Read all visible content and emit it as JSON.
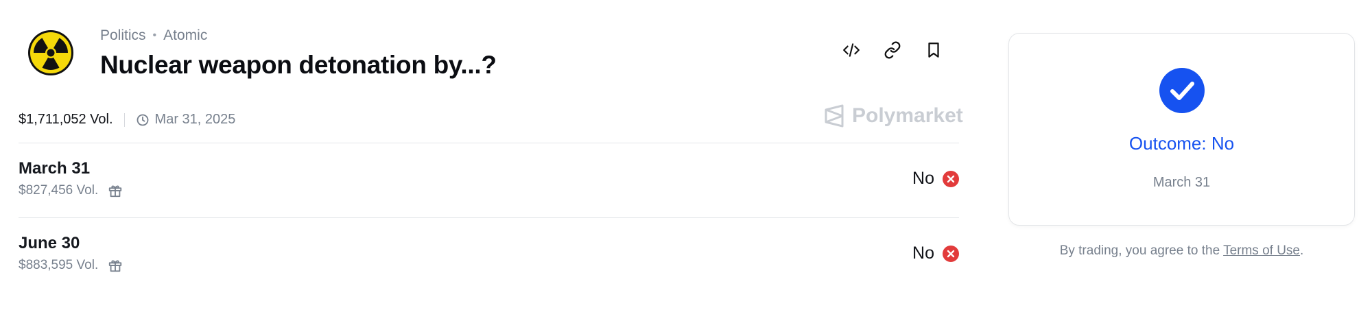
{
  "header": {
    "category": "Politics",
    "subcategory": "Atomic",
    "title": "Nuclear weapon detonation by...?",
    "icon": "radiation-icon"
  },
  "actions": [
    {
      "name": "embed-code-icon"
    },
    {
      "name": "copy-link-icon"
    },
    {
      "name": "bookmark-icon"
    }
  ],
  "meta": {
    "volume": "$1,711,052 Vol.",
    "end_date": "Mar 31, 2025"
  },
  "brand": {
    "name": "Polymarket"
  },
  "outcomes": [
    {
      "date": "March 31",
      "volume": "$827,456 Vol.",
      "result": "No"
    },
    {
      "date": "June 30",
      "volume": "$883,595 Vol.",
      "result": "No"
    }
  ],
  "resolution_card": {
    "outcome_text": "Outcome: No",
    "date": "March 31"
  },
  "footer": {
    "terms_prefix": "By trading, you agree to the ",
    "terms_link": "Terms of Use",
    "terms_suffix": "."
  },
  "colors": {
    "accent": "#1652f0",
    "negative": "#e23b3b",
    "radiation_yellow": "#f5d90a"
  }
}
